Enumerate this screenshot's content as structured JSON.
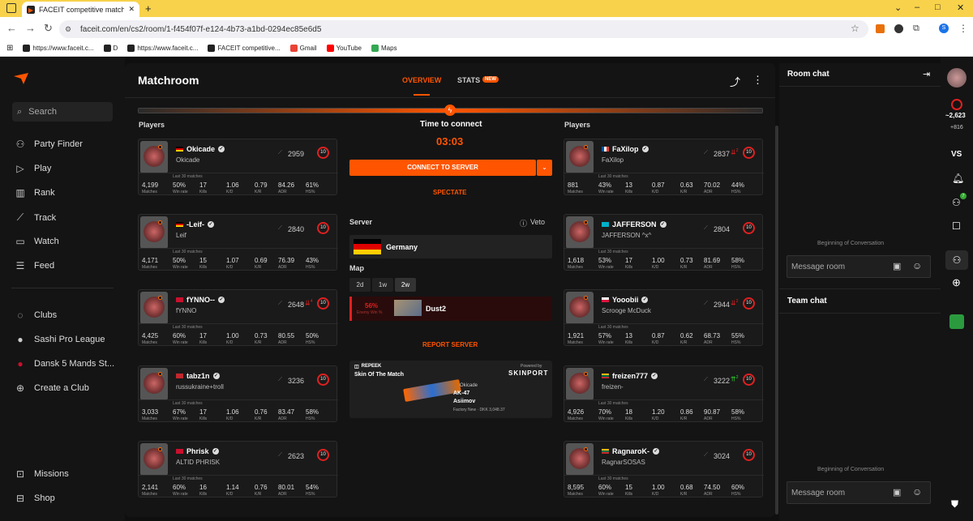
{
  "browser": {
    "tab_title": "FACEIT competitive match - FACE",
    "url": "faceit.com/en/cs2/room/1-f454f07f-e124-4b73-a1bd-0294ec85e6d5",
    "bookmarks": [
      "https://www.faceit.c...",
      "D",
      "https://www.faceit.c...",
      "FACEIT competitive...",
      "Gmail",
      "YouTube",
      "Maps"
    ]
  },
  "sidebar": {
    "search_label": "Search",
    "items": [
      {
        "label": "Party Finder",
        "icon": "party-icon"
      },
      {
        "label": "Play",
        "icon": "play-icon"
      },
      {
        "label": "Rank",
        "icon": "rank-icon"
      },
      {
        "label": "Track",
        "icon": "track-icon"
      },
      {
        "label": "Watch",
        "icon": "watch-icon"
      },
      {
        "label": "Feed",
        "icon": "feed-icon"
      }
    ],
    "clubs": [
      {
        "label": "Clubs"
      },
      {
        "label": "Sashi Pro League"
      },
      {
        "label": "Dansk 5 Mands St..."
      },
      {
        "label": "Create a Club"
      }
    ],
    "bottom": [
      {
        "label": "Missions"
      },
      {
        "label": "Shop"
      }
    ]
  },
  "header": {
    "title": "Matchroom",
    "tab_overview": "OVERVIEW",
    "tab_stats": "STATS",
    "badge_new": "NEW"
  },
  "labels": {
    "players": "Players",
    "last30": "Last 30 matches",
    "matches": "Matches",
    "winrate": "Win rate",
    "kills": "Kills",
    "kd": "K/D",
    "kr": "K/R",
    "adr": "ADR",
    "hs": "HS%"
  },
  "team_left": [
    {
      "nick": "Okicade",
      "sub": "Okicade",
      "elo": "2959",
      "level": "10",
      "matches": "4,199",
      "winrate": "50%",
      "kills": "17",
      "kd": "1.06",
      "kr": "0.79",
      "adr": "84.26",
      "hs": "61%",
      "flag": "de",
      "arrow": "",
      "arrow_n": ""
    },
    {
      "nick": "-Leif-",
      "sub": "Leif",
      "elo": "2840",
      "level": "10",
      "matches": "4,171",
      "winrate": "50%",
      "kills": "15",
      "kd": "1.07",
      "kr": "0.69",
      "adr": "76.39",
      "hs": "43%",
      "flag": "de",
      "arrow": "",
      "arrow_n": ""
    },
    {
      "nick": "fYNNO--",
      "sub": "fYNNO",
      "elo": "2648",
      "level": "10",
      "matches": "4,425",
      "winrate": "60%",
      "kills": "17",
      "kd": "1.00",
      "kr": "0.73",
      "adr": "80.55",
      "hs": "50%",
      "flag": "dk",
      "arrow": "down",
      "arrow_n": "4"
    },
    {
      "nick": "tabz1n",
      "sub": "russukraine+troll",
      "elo": "3236",
      "level": "10",
      "matches": "3,033",
      "winrate": "67%",
      "kills": "17",
      "kd": "1.06",
      "kr": "0.76",
      "adr": "83.47",
      "hs": "58%",
      "flag": "ma",
      "arrow": "",
      "arrow_n": ""
    },
    {
      "nick": "Phrisk",
      "sub": "ALTID PHRISK",
      "elo": "2623",
      "level": "10",
      "matches": "2,141",
      "winrate": "60%",
      "kills": "16",
      "kd": "1.14",
      "kr": "0.76",
      "adr": "80.01",
      "hs": "54%",
      "flag": "dk",
      "arrow": "",
      "arrow_n": ""
    }
  ],
  "team_right": [
    {
      "nick": "FaXilop",
      "sub": "FaXilop",
      "elo": "2837",
      "level": "10",
      "matches": "881",
      "winrate": "43%",
      "kills": "13",
      "kd": "0.87",
      "kr": "0.63",
      "adr": "70.02",
      "hs": "44%",
      "flag": "fr",
      "arrow": "down",
      "arrow_n": "2"
    },
    {
      "nick": "JAFFERSON",
      "sub": "JAFFERSON ^x^",
      "elo": "2804",
      "level": "10",
      "matches": "1,618",
      "winrate": "53%",
      "kills": "17",
      "kd": "1.00",
      "kr": "0.73",
      "adr": "81.69",
      "hs": "58%",
      "flag": "kz",
      "arrow": "",
      "arrow_n": ""
    },
    {
      "nick": "Yooobii",
      "sub": "Scrooge McDuck",
      "elo": "2944",
      "level": "10",
      "matches": "1,921",
      "winrate": "57%",
      "kills": "13",
      "kd": "0.87",
      "kr": "0.62",
      "adr": "68.73",
      "hs": "55%",
      "flag": "pl",
      "arrow": "down",
      "arrow_n": "2"
    },
    {
      "nick": "freizen777",
      "sub": "freizen-",
      "elo": "3222",
      "level": "10",
      "matches": "4,926",
      "winrate": "70%",
      "kills": "18",
      "kd": "1.20",
      "kr": "0.86",
      "adr": "90.87",
      "hs": "58%",
      "flag": "lt",
      "arrow": "up",
      "arrow_n": "2"
    },
    {
      "nick": "RagnaroK-",
      "sub": "RagnarSOSAS",
      "elo": "3024",
      "level": "10",
      "matches": "8,595",
      "winrate": "60%",
      "kills": "15",
      "kd": "1.00",
      "kr": "0.68",
      "adr": "74.50",
      "hs": "60%",
      "flag": "lt",
      "arrow": "",
      "arrow_n": ""
    }
  ],
  "center": {
    "time_to_connect": "Time to connect",
    "timer": "03:03",
    "connect": "CONNECT TO SERVER",
    "spectate": "SPECTATE",
    "server_label": "Server",
    "veto": "Veto",
    "server_name": "Germany",
    "map_label": "Map",
    "map_filters": [
      "2d",
      "1w",
      "2w"
    ],
    "map_pct": "56%",
    "map_pct_label": "Enemy Win %",
    "map_name": "Dust2",
    "report": "REPORT SERVER",
    "sotm_brand": "REPEEK",
    "sotm_title": "Skin Of The Match",
    "powered_by": "Powered by",
    "skinport": "SKINPORT",
    "sotm_player": "Okicade",
    "weapon": "AK-47",
    "skin": "Asiimov",
    "skin_meta": "Factory New · DKK 3,048.37"
  },
  "chat": {
    "room_title": "Room chat",
    "beginning": "Beginning of Conversation",
    "placeholder": "Message room",
    "team_title": "Team chat"
  },
  "rail": {
    "elo": "~2,623",
    "delta": "+816",
    "vs": "VS",
    "friends_online": "7"
  },
  "colors": {
    "accent": "#ff5500",
    "level": "#e02020"
  }
}
